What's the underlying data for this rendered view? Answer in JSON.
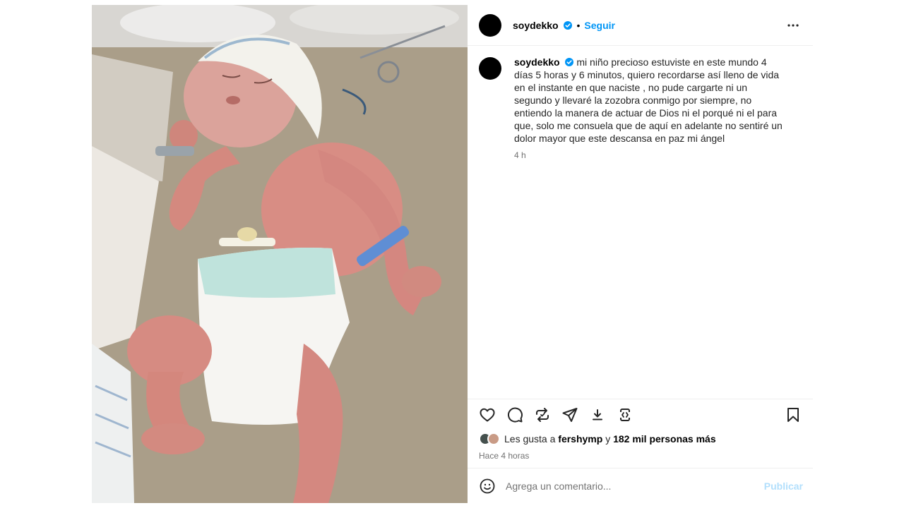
{
  "post": {
    "username": "soydekko",
    "follow_label": "Seguir",
    "separator": "•",
    "caption_username": "soydekko",
    "caption": "mi niño precioso estuviste en este mundo 4 días 5 horas y 6 minutos, quiero recordarse así lleno de vida en el instante en que naciste , no pude cargarte ni un segundo y llevaré la zozobra conmigo por siempre, no entiendo la manera de actuar de Dios ni el porqué ni el para que, solo me consuela que de aquí en adelante no sentiré un dolor mayor que este descansa en paz mi ángel",
    "caption_time": "4 h",
    "likes_prefix": "Les gusta a",
    "likes_user": "fershymp",
    "likes_joiner": "y",
    "likes_count": "182 mil personas más",
    "posted_ago": "Hace 4 horas"
  },
  "comment": {
    "placeholder": "Agrega un comentario...",
    "publish_label": "Publicar"
  },
  "icons": {
    "verified": "verified-badge-icon",
    "more": "more-options-icon",
    "like": "heart-icon",
    "comment": "comment-icon",
    "repost": "repost-icon",
    "share": "share-icon",
    "download": "download-icon",
    "remix": "remix-icon",
    "save": "bookmark-icon",
    "emoji": "emoji-icon"
  },
  "colors": {
    "accent": "#0095f6",
    "publish_disabled": "#b2dffc",
    "secondary_text": "#737373"
  }
}
